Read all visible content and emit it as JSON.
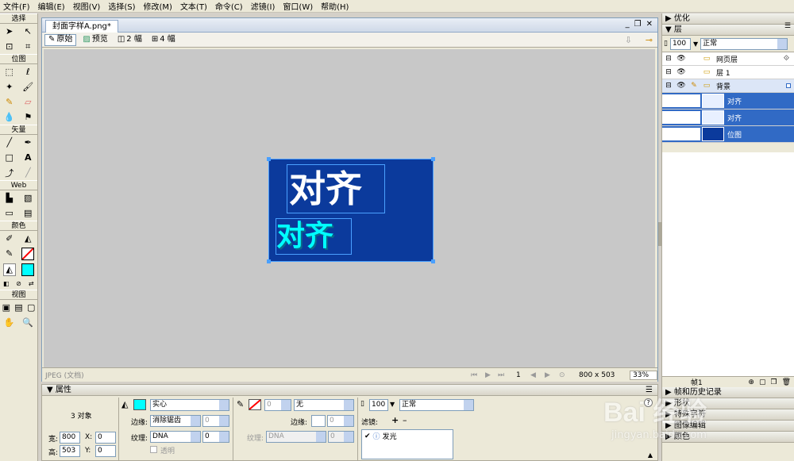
{
  "menu": [
    "文件(F)",
    "编辑(E)",
    "视图(V)",
    "选择(S)",
    "修改(M)",
    "文本(T)",
    "命令(C)",
    "滤镜(I)",
    "窗口(W)",
    "帮助(H)"
  ],
  "tools": {
    "sections": [
      "选择",
      "位图",
      "矢量",
      "Web",
      "颜色",
      "视图"
    ],
    "stroke_color": "#ff0000",
    "fill_color": "#00ffff"
  },
  "document": {
    "tab_title": "封面字样A.png*",
    "views": [
      "原始",
      "预览",
      "2 幅",
      "4 幅"
    ],
    "canvas": {
      "bg_color": "#0b3a9c",
      "text_large": "对齐",
      "text_small": "对齐",
      "text_small_color": "#00ffff"
    },
    "status": {
      "format": "JPEG (文档)",
      "frame": "1",
      "size": "800 x 503",
      "zoom": "33%"
    }
  },
  "panels": {
    "optimize": "优化",
    "layers": "层",
    "opacity": "100",
    "blend": "正常",
    "layer_rows": [
      {
        "name": "网页层",
        "indent": 0,
        "selected": false
      },
      {
        "name": "层 1",
        "indent": 0,
        "selected": false
      },
      {
        "name": "背景",
        "indent": 0,
        "selected": true
      },
      {
        "name": "对齐",
        "indent": 1,
        "selected": true
      },
      {
        "name": "对齐",
        "indent": 1,
        "selected": true
      },
      {
        "name": "位图",
        "indent": 1,
        "selected": true
      }
    ],
    "frames_label": "帧1",
    "bottom": [
      "帧和历史记录",
      "形状",
      "特殊字符",
      "图像编辑",
      "颜色"
    ]
  },
  "properties": {
    "title": "属性",
    "selection": "3 对象",
    "width_label": "宽:",
    "width": "800",
    "height_label": "高:",
    "height": "503",
    "x_label": "X:",
    "x": "0",
    "y_label": "Y:",
    "y": "0",
    "fill_type": "实心",
    "edge_label": "边缘:",
    "edge": "消除锯齿",
    "edge_amount": "0",
    "texture_label": "纹理:",
    "texture": "DNA",
    "texture_amount": "0",
    "transparent": "透明",
    "stroke_size": "0",
    "stroke_type": "无",
    "stroke_edge_label": "边缘:",
    "stroke_edge": "0",
    "stroke_texture_label": "纹理:",
    "stroke_texture": "DNA",
    "stroke_texture_amount": "0",
    "opacity": "100",
    "blend": "正常",
    "filters_label": "滤镜:",
    "filter_item": "发光"
  },
  "watermark": {
    "main": "Bai 经验",
    "sub": "jingyan.baidu.com"
  }
}
